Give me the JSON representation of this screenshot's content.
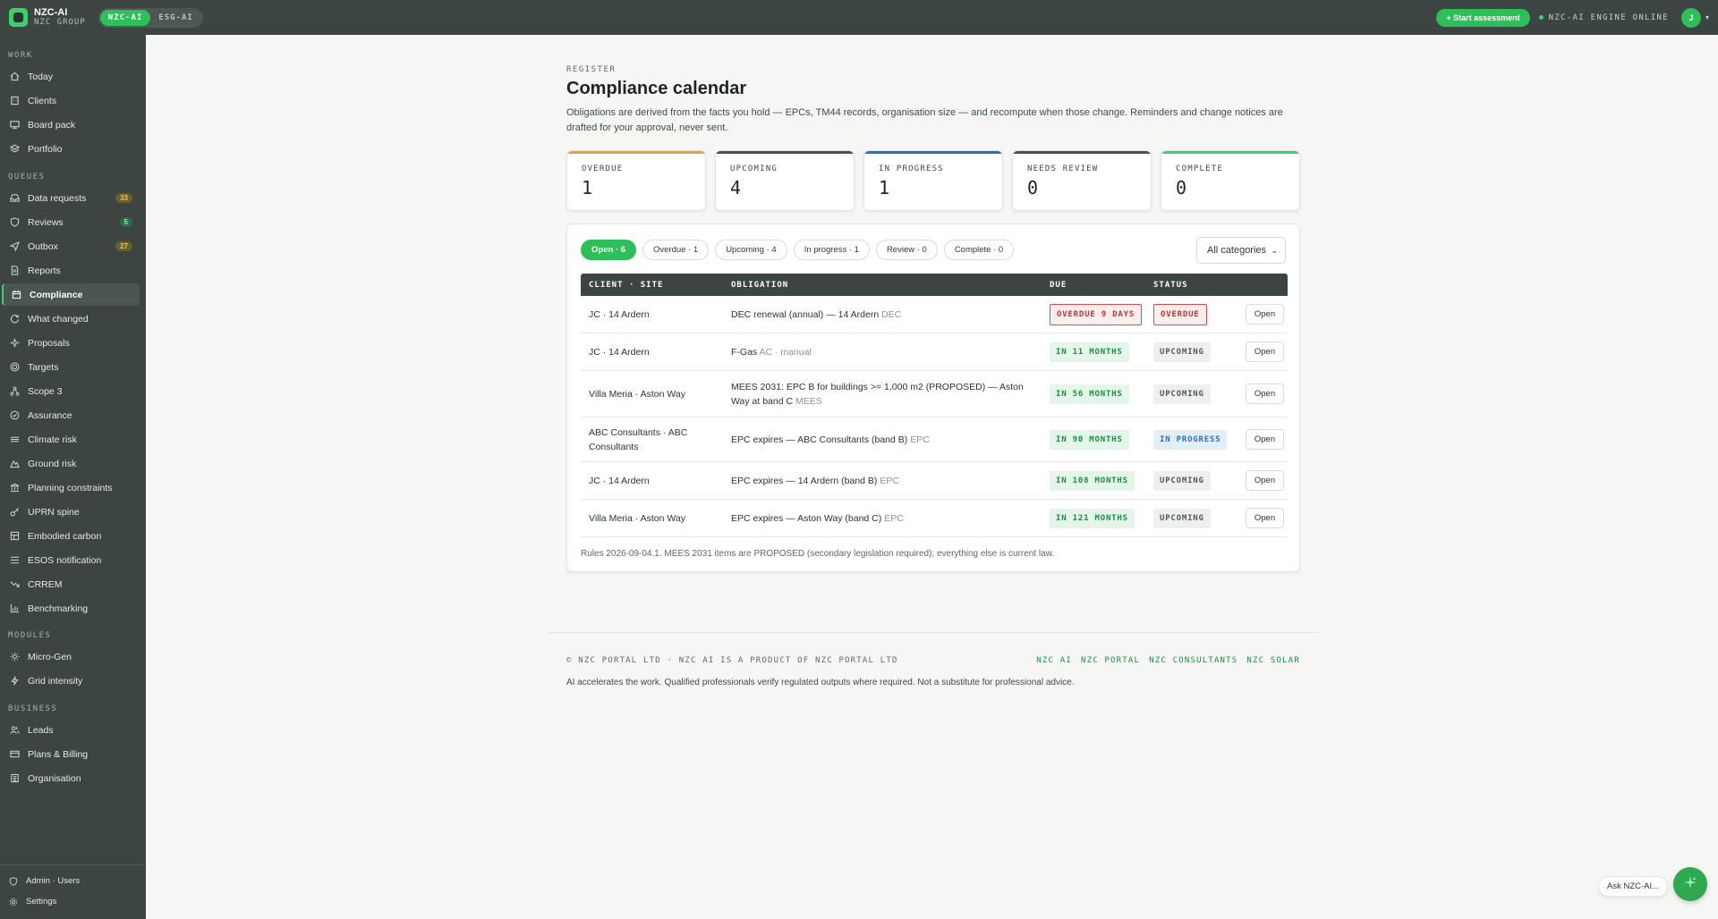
{
  "header": {
    "brand_name": "NZC-AI",
    "brand_sub": "NZC GROUP",
    "switch": [
      "NZC-AI",
      "ESG-AI"
    ],
    "start_button": "+ Start assessment",
    "engine_status": "NZC-AI ENGINE ONLINE",
    "avatar_initial": "J"
  },
  "sidebar": {
    "sections": {
      "work": "WORK",
      "queues": "QUEUES",
      "modules": "MODULES",
      "business": "BUSINESS"
    },
    "work": [
      {
        "label": "Today",
        "icon": "home-icon"
      },
      {
        "label": "Clients",
        "icon": "building-icon"
      },
      {
        "label": "Board pack",
        "icon": "monitor-icon"
      },
      {
        "label": "Portfolio",
        "icon": "layers-icon"
      }
    ],
    "queues": [
      {
        "label": "Data requests",
        "icon": "inbox-icon",
        "badge": "33"
      },
      {
        "label": "Reviews",
        "icon": "shield-icon",
        "badge": "5"
      },
      {
        "label": "Outbox",
        "icon": "send-icon",
        "badge": "27"
      },
      {
        "label": "Reports",
        "icon": "document-icon"
      },
      {
        "label": "Compliance",
        "icon": "calendar-icon"
      },
      {
        "label": "What changed",
        "icon": "refresh-icon"
      },
      {
        "label": "Proposals",
        "icon": "sparkle-icon"
      },
      {
        "label": "Targets",
        "icon": "target-icon"
      },
      {
        "label": "Scope 3",
        "icon": "network-icon"
      },
      {
        "label": "Assurance",
        "icon": "check-circle-icon"
      },
      {
        "label": "Climate risk",
        "icon": "waves-icon"
      },
      {
        "label": "Ground risk",
        "icon": "mountain-icon"
      },
      {
        "label": "Planning constraints",
        "icon": "bank-icon"
      },
      {
        "label": "UPRN spine",
        "icon": "key-icon"
      },
      {
        "label": "Embodied carbon",
        "icon": "box-icon"
      },
      {
        "label": "ESOS notification",
        "icon": "list-icon"
      },
      {
        "label": "CRREM",
        "icon": "trend-down-icon"
      },
      {
        "label": "Benchmarking",
        "icon": "bar-chart-icon"
      }
    ],
    "modules": [
      {
        "label": "Micro-Gen",
        "icon": "sun-icon"
      },
      {
        "label": "Grid intensity",
        "icon": "bolt-icon"
      }
    ],
    "business": [
      {
        "label": "Leads",
        "icon": "users-icon"
      },
      {
        "label": "Plans & Billing",
        "icon": "card-icon"
      },
      {
        "label": "Organisation",
        "icon": "org-icon"
      }
    ],
    "bottom": [
      {
        "label": "Admin · Users",
        "icon": "shield-icon"
      },
      {
        "label": "Settings",
        "icon": "gear-icon"
      }
    ]
  },
  "page": {
    "eyebrow": "REGISTER",
    "title": "Compliance calendar",
    "description": "Obligations are derived from the facts you hold — EPCs, TM44 records, organisation size — and recompute when those change. Reminders and change notices are drafted for your approval, never sent."
  },
  "stats": [
    {
      "label": "OVERDUE",
      "value": "1",
      "color": "#e8a23a"
    },
    {
      "label": "UPCOMING",
      "value": "4",
      "color": "#4a524e"
    },
    {
      "label": "IN PROGRESS",
      "value": "1",
      "color": "#2d6fbf"
    },
    {
      "label": "NEEDS REVIEW",
      "value": "0",
      "color": "#4a524e"
    },
    {
      "label": "COMPLETE",
      "value": "0",
      "color": "#3fcf6a"
    }
  ],
  "filters": [
    "Open · 6",
    "Overdue · 1",
    "Upcoming · 4",
    "In progress · 1",
    "Review · 0",
    "Complete · 0"
  ],
  "category_select": "All categories",
  "table": {
    "headers": [
      "CLIENT · SITE",
      "OBLIGATION",
      "DUE",
      "STATUS"
    ],
    "rows": [
      {
        "client": "JC · 14 Ardern",
        "obligation": "DEC renewal (annual) — 14 Ardern",
        "tag": "DEC",
        "due": "OVERDUE 9 DAYS",
        "status": "OVERDUE",
        "action": "Open"
      },
      {
        "client": "JC · 14 Ardern",
        "obligation": "F-Gas",
        "tag": "AC · manual",
        "due": "IN 11 MONTHS",
        "status": "UPCOMING",
        "action": "Open"
      },
      {
        "client": "Villa Meria · Aston Way",
        "obligation": "MEES 2031: EPC B for buildings >= 1,000 m2 (PROPOSED) — Aston Way at band C",
        "tag": "MEES",
        "due": "IN 56 MONTHS",
        "status": "UPCOMING",
        "action": "Open"
      },
      {
        "client": "ABC Consultants · ABC Consultants",
        "obligation": "EPC expires — ABC Consultants (band B)",
        "tag": "EPC",
        "due": "IN 90 MONTHS",
        "status": "IN PROGRESS",
        "action": "Open"
      },
      {
        "client": "JC · 14 Ardern",
        "obligation": "EPC expires — 14 Ardern (band B)",
        "tag": "EPC",
        "due": "IN 108 MONTHS",
        "status": "UPCOMING",
        "action": "Open"
      },
      {
        "client": "Villa Meria · Aston Way",
        "obligation": "EPC expires — Aston Way (band C)",
        "tag": "EPC",
        "due": "IN 121 MONTHS",
        "status": "UPCOMING",
        "action": "Open"
      }
    ],
    "note": "Rules 2026-09-04.1. MEES 2031 items are PROPOSED (secondary legislation required); everything else is current law."
  },
  "footer": {
    "copyright": "© NZC PORTAL LTD · NZC AI IS A PRODUCT OF NZC PORTAL LTD",
    "links": [
      "NZC AI",
      "NZC PORTAL",
      "NZC CONSULTANTS",
      "NZC SOLAR"
    ],
    "disclaimer": "AI accelerates the work. Qualified professionals verify regulated outputs where required. Not a substitute for professional advice."
  },
  "assistant": {
    "label": "Ask NZC-AI..."
  }
}
